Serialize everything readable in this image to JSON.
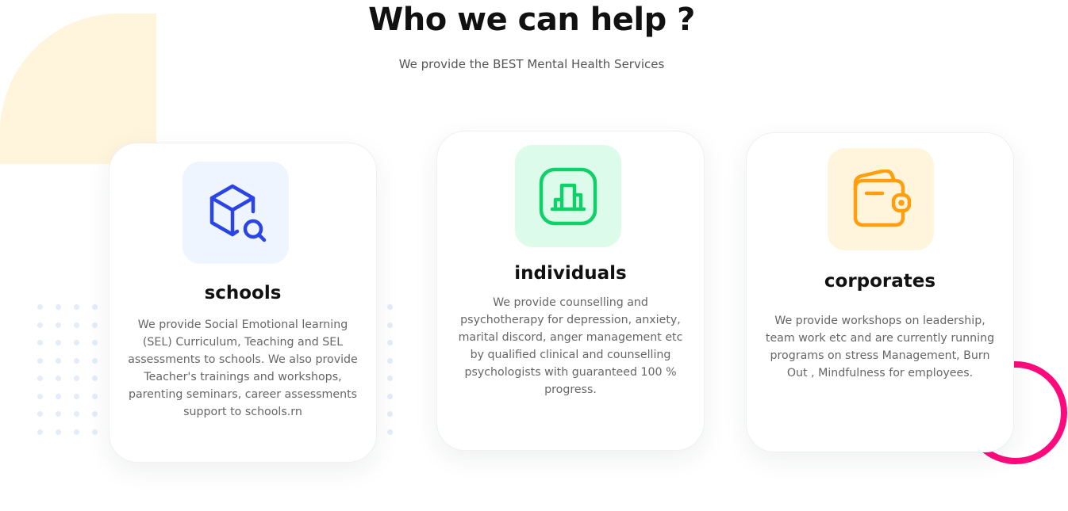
{
  "header": {
    "title": "Who we can help ?",
    "subtitle": "We provide the BEST Mental Health Services"
  },
  "cards": [
    {
      "icon": "box-search-icon",
      "icon_color": "#2b44e6",
      "tile_color": "#eef5ff",
      "title": "schools",
      "text": "We provide Social Emotional learning (SEL) Curriculum, Teaching and SEL assessments to schools. We also provide Teacher's trainings and workshops, parenting seminars, career assessments support to schools.rn"
    },
    {
      "icon": "chart-square-icon",
      "icon_color": "#10d06a",
      "tile_color": "#ddfbea",
      "title": "individuals",
      "text": "We provide counselling and psychotherapy for depression, anxiety, marital discord, anger management etc by qualified clinical and counselling psychologists with guaranteed 100 % progress."
    },
    {
      "icon": "wallet-icon",
      "icon_color": "#ff9f10",
      "tile_color": "#fff5dc",
      "title": "corporates",
      "text": "We provide workshops on leadership, team work etc and are currently running programs on stress Management, Burn Out , Mindfulness for employees."
    }
  ],
  "decor": {
    "ring_color": "#ff0a7d",
    "blob_color": "#fff5dc"
  }
}
